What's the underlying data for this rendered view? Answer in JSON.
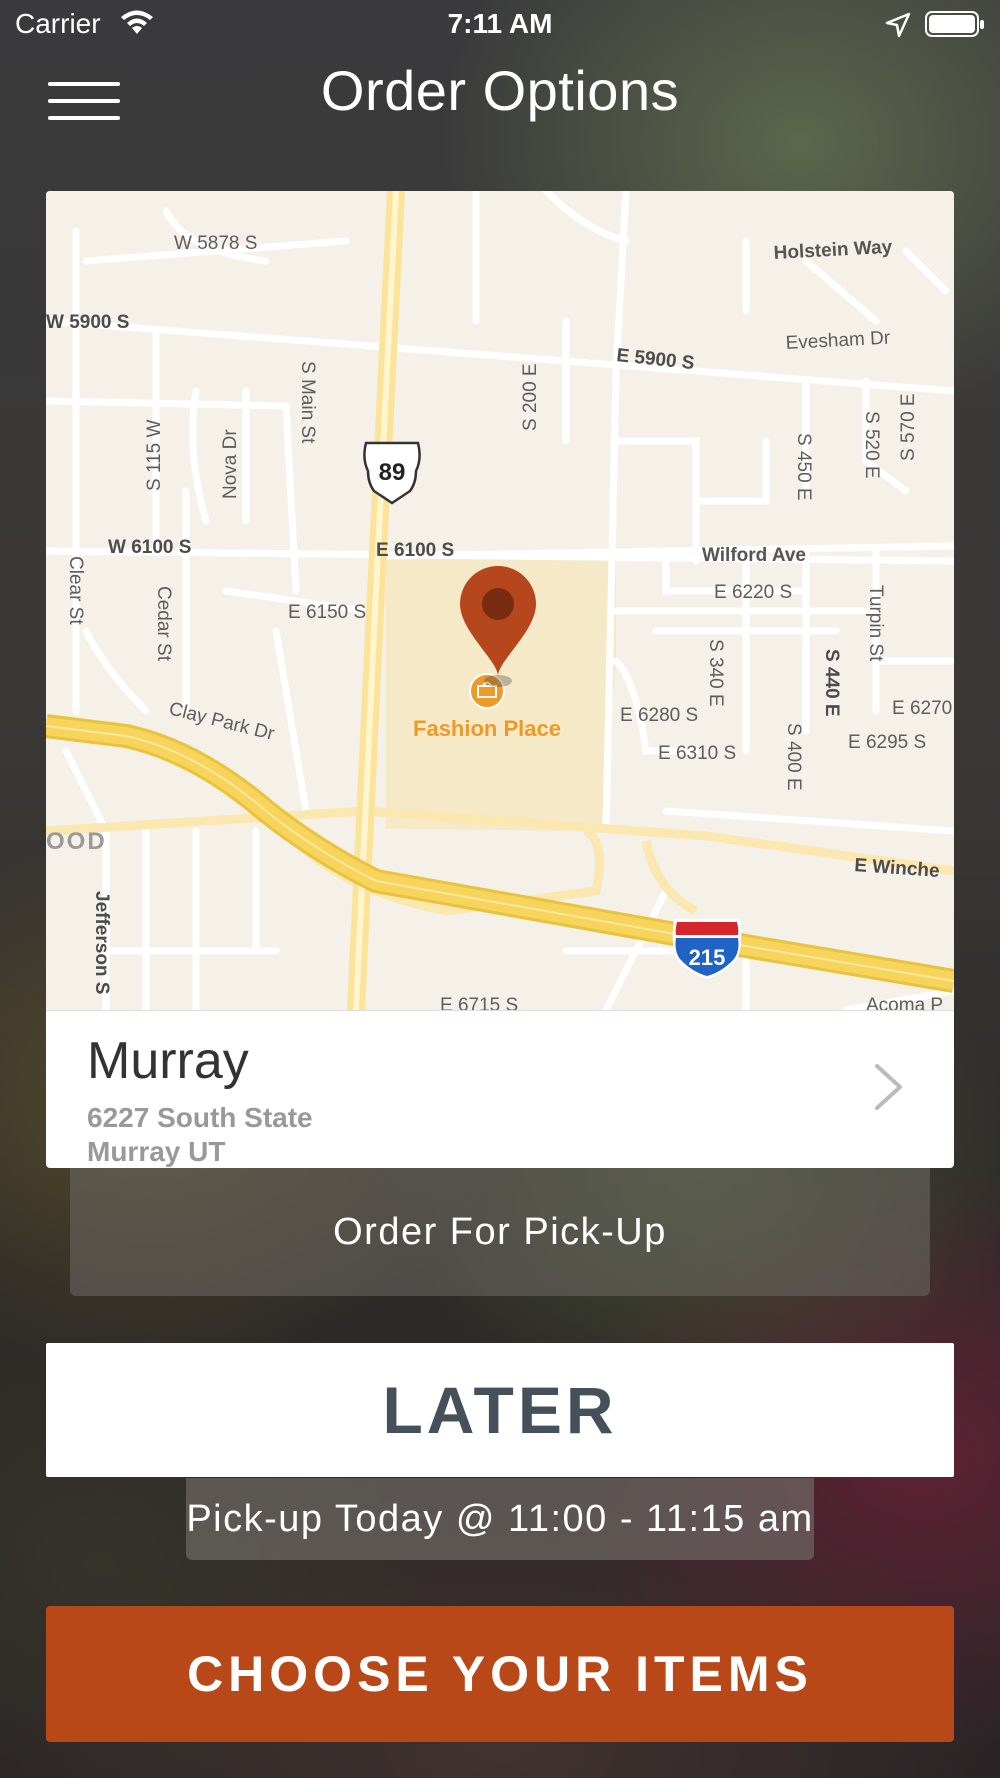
{
  "status_bar": {
    "carrier": "Carrier",
    "time": "7:11 AM",
    "icons": [
      "wifi-icon",
      "location-arrow-icon",
      "battery-icon"
    ]
  },
  "header": {
    "title": "Order Options",
    "menu_icon": "menu-icon"
  },
  "map": {
    "highway_us": "89",
    "highway_interstate": "215",
    "poi_name": "Fashion Place",
    "labels": {
      "w5878s": "W 5878 S",
      "w5900s": "W 5900 S",
      "holstein": "Holstein Way",
      "e5900s": "E 5900 S",
      "evesham": "Evesham Dr",
      "s200e": "S 200 E",
      "smain": "S Main St",
      "s115w": "S 115 W",
      "nova": "Nova Dr",
      "s450e": "S 450 E",
      "s520e": "S 520 E",
      "s570e": "S 570 E",
      "w6100s": "W 6100 S",
      "e6100s": "E 6100 S",
      "wilford": "Wilford Ave",
      "e6220s": "E 6220 S",
      "clear": "Clear St",
      "cedar": "Cedar St",
      "e6150s": "E 6150 S",
      "s340e": "S 340 E",
      "s440e": "S 440 E",
      "turpin": "Turpin St",
      "clay": "Clay Park Dr",
      "e6280s": "E 6280 S",
      "e6310s": "E 6310 S",
      "s400e": "S 400 E",
      "e6270": "E 6270",
      "e6295s": "E 6295 S",
      "ood": "OOD",
      "ewinche": "E Winche",
      "jefferson": "Jefferson S",
      "e6715s": "E 6715 S",
      "acoma": "Acoma P"
    }
  },
  "store": {
    "name": "Murray",
    "address_line1": "6227 South State",
    "address_line2": "Murray UT"
  },
  "order_type": "Order For Pick-Up",
  "timing_button": "LATER",
  "pickup_time": "Pick-up Today @ 11:00 - 11:15 am",
  "cta_button": "CHOOSE YOUR ITEMS",
  "colors": {
    "cta": "#b84818",
    "map_pin": "#b6461b",
    "poi": "#ee9a2a",
    "highway": "#f7d45c"
  }
}
